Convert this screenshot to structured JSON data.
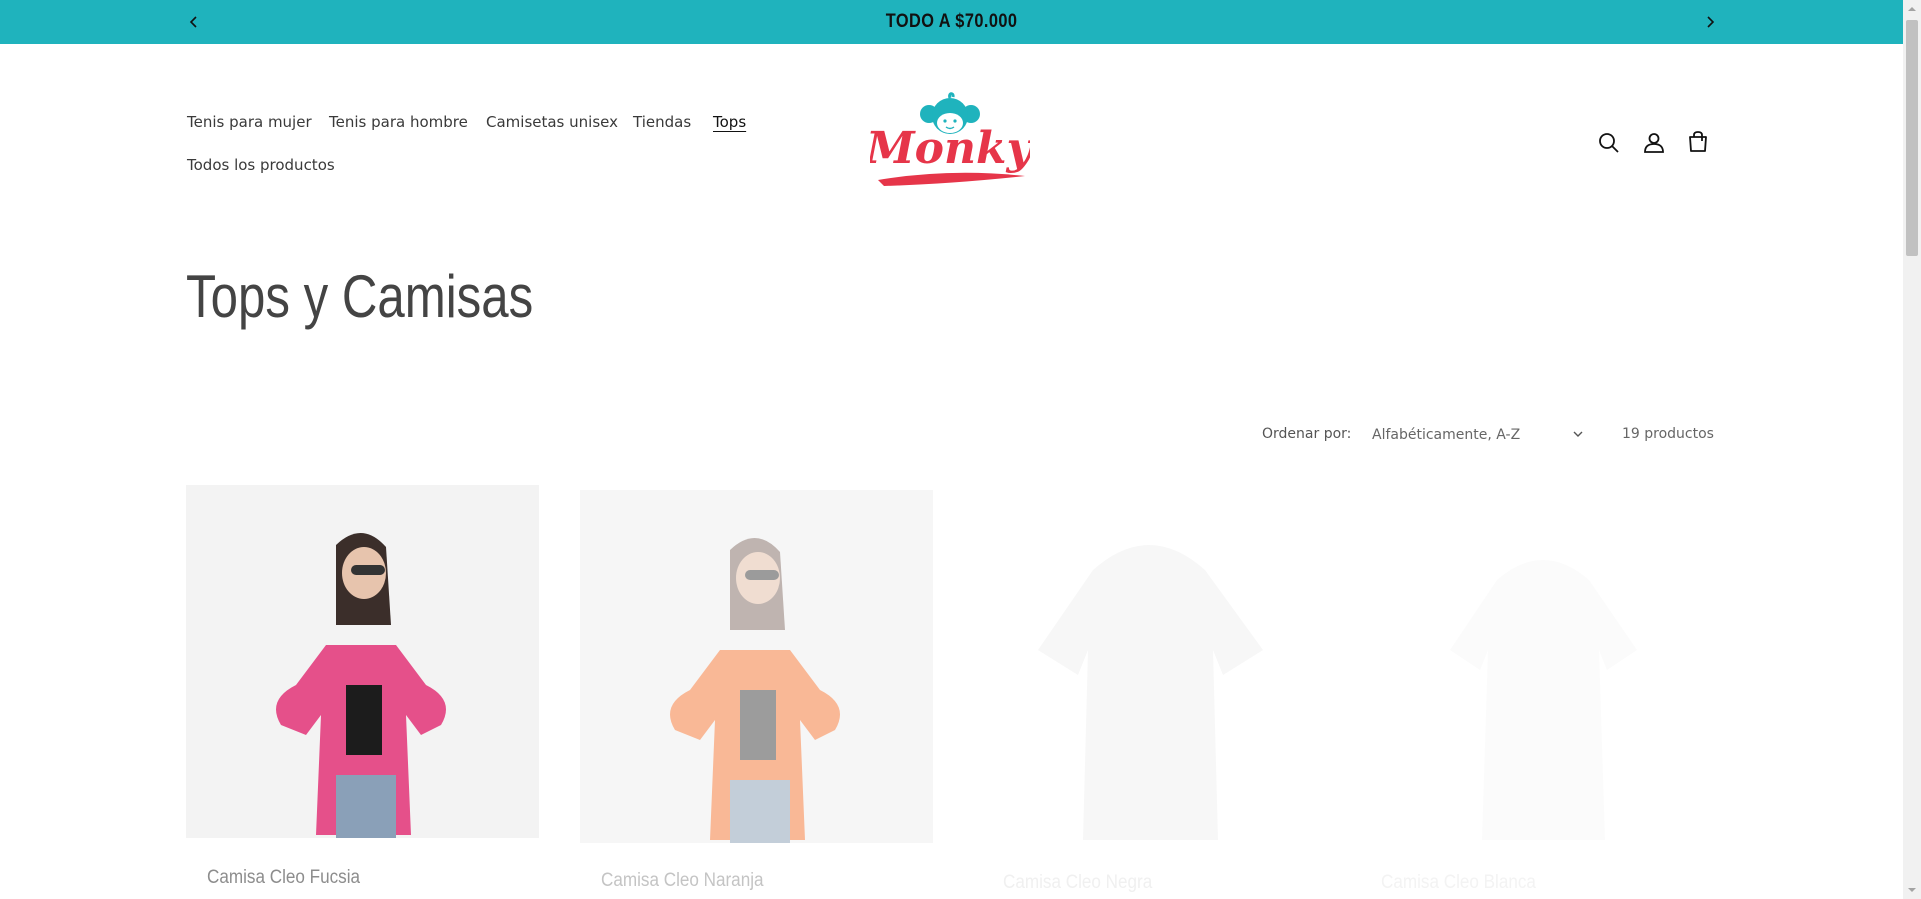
{
  "announcement": {
    "text": "TODO A $70.000"
  },
  "nav": {
    "items": [
      {
        "label": "Tenis para mujer",
        "active": false
      },
      {
        "label": "Tenis para hombre",
        "active": false
      },
      {
        "label": "Camisetas unisex",
        "active": false
      },
      {
        "label": "Tiendas",
        "active": false
      },
      {
        "label": "Tops",
        "active": true
      },
      {
        "label": "Todos los productos",
        "active": false
      }
    ]
  },
  "logo": {
    "text": "Monky"
  },
  "header_icons": [
    "search-icon",
    "account-icon",
    "cart-icon"
  ],
  "collection": {
    "title": "Tops y Camisas",
    "sort_label": "Ordenar por:",
    "sort_value": "Alfabéticamente, A-Z",
    "product_count": "19 productos"
  },
  "products": [
    {
      "title": "Camisa Cleo Fucsia",
      "color": "#e5508a"
    },
    {
      "title": "Camisa Cleo Naranja",
      "color": "#f79a6a"
    },
    {
      "title": "Camisa Cleo Negra",
      "color": "#222222"
    },
    {
      "title": "Camisa Cleo Blanca",
      "color": "#f6f6f6"
    }
  ],
  "colors": {
    "accent": "#1fb3bd",
    "brand_red": "#e63549",
    "logo_teal": "#1fb3bd"
  }
}
